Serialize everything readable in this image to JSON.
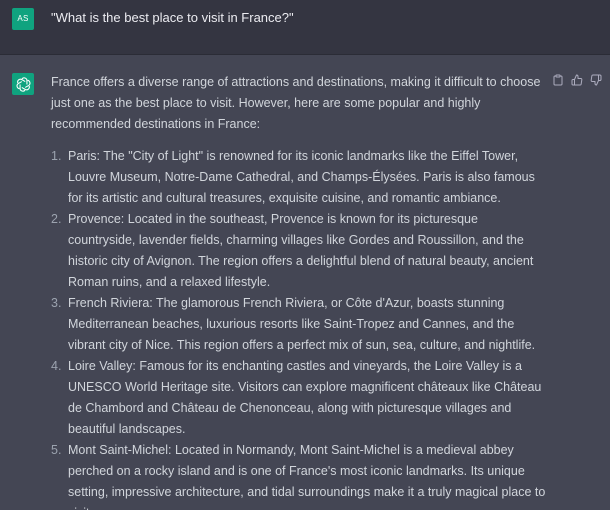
{
  "user": {
    "avatar_initials": "AS",
    "avatar_color": "#10a37f",
    "message": "\"What is the best place to visit in France?\""
  },
  "assistant": {
    "avatar_icon": "openai-logo-icon",
    "avatar_color": "#10a37f",
    "actions": [
      "copy-icon",
      "thumbs-up-icon",
      "thumbs-down-icon"
    ],
    "intro": "France offers a diverse range of attractions and destinations, making it difficult to choose just one as the best place to visit. However, here are some popular and highly recommended destinations in France:",
    "items": [
      {
        "number": "1.",
        "text": "Paris: The \"City of Light\" is renowned for its iconic landmarks like the Eiffel Tower, Louvre Museum, Notre-Dame Cathedral, and Champs-Élysées. Paris is also famous for its artistic and cultural treasures, exquisite cuisine, and romantic ambiance."
      },
      {
        "number": "2.",
        "text": "Provence: Located in the southeast, Provence is known for its picturesque countryside, lavender fields, charming villages like Gordes and Roussillon, and the historic city of Avignon. The region offers a delightful blend of natural beauty, ancient Roman ruins, and a relaxed lifestyle."
      },
      {
        "number": "3.",
        "text": "French Riviera: The glamorous French Riviera, or Côte d'Azur, boasts stunning Mediterranean beaches, luxurious resorts like Saint-Tropez and Cannes, and the vibrant city of Nice. This region offers a perfect mix of sun, sea, culture, and nightlife."
      },
      {
        "number": "4.",
        "text": "Loire Valley: Famous for its enchanting castles and vineyards, the Loire Valley is a UNESCO World Heritage site. Visitors can explore magnificent châteaux like Château de Chambord and Château de Chenonceau, along with picturesque villages and beautiful landscapes."
      },
      {
        "number": "5.",
        "text": "Mont Saint-Michel: Located in Normandy, Mont Saint-Michel is a medieval abbey perched on a rocky island and is one of France's most iconic landmarks. Its unique setting, impressive architecture, and tidal surroundings make it a truly magical place to visit."
      }
    ]
  }
}
